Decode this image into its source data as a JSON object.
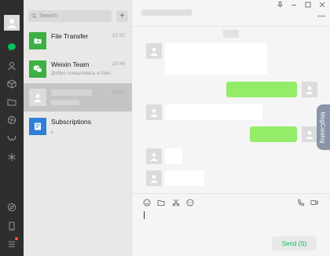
{
  "sidebar": {
    "icons": [
      "chats-icon",
      "contacts-icon",
      "favorites-icon",
      "folder-icon",
      "moments-icon",
      "channels-icon",
      "discover-icon",
      "mini-programs-icon",
      "phone-icon",
      "menu-icon"
    ],
    "badge_color": "#fa5151"
  },
  "chat_list": {
    "search_placeholder": "Search",
    "add_label": "+",
    "items": [
      {
        "title": "File Transfer",
        "time": "21:32",
        "preview": ""
      },
      {
        "title": "Weixin Team",
        "time": "20:46",
        "preview": "Добро пожаловать в Wei..."
      },
      {
        "title": "",
        "time": "20:51",
        "preview": ""
      },
      {
        "title": "Subscriptions",
        "time": "",
        "preview": ""
      }
    ]
  },
  "chat": {
    "msg_catalog_label": "MsgCatalog",
    "send_label": "Send (S)"
  },
  "colors": {
    "accent": "#07c160",
    "outgoing_bubble": "#95ec69",
    "rail": "#2e2e2e",
    "file_transfer": "#3cb043",
    "subscriptions": "#2f7fd6"
  }
}
